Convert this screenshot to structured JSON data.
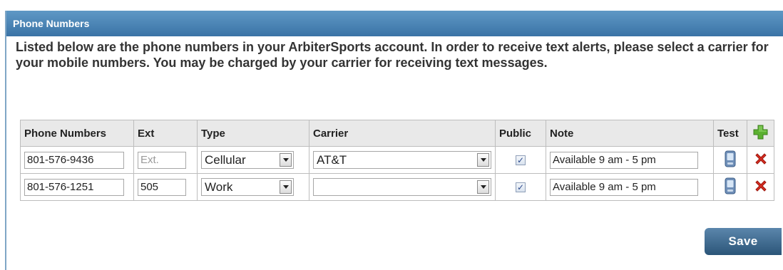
{
  "panel": {
    "title": "Phone Numbers"
  },
  "intro": "Listed below are the phone numbers in your ArbiterSports account. In order to receive text alerts, please select a carrier for your mobile numbers. You may be charged by your carrier for receiving text messages.",
  "table": {
    "headers": {
      "phone": "Phone Numbers",
      "ext": "Ext",
      "type": "Type",
      "carrier": "Carrier",
      "public": "Public",
      "note": "Note",
      "test": "Test"
    },
    "rows": [
      {
        "phone": "801-576-9436",
        "ext": "",
        "ext_placeholder": "Ext.",
        "type": "Cellular",
        "carrier": "AT&T",
        "public": true,
        "note": "Available 9 am - 5 pm"
      },
      {
        "phone": "801-576-1251",
        "ext": "505",
        "ext_placeholder": "Ext.",
        "type": "Work",
        "carrier": "",
        "public": true,
        "note": "Available 9 am - 5 pm"
      }
    ]
  },
  "save_label": "Save",
  "colors": {
    "header_bar": "#3b73a6",
    "save_button": "#2b5578",
    "add_icon": "#5bb030",
    "delete_icon": "#d62b1f"
  },
  "icons": {
    "add": "plus-icon",
    "delete": "delete-x-icon",
    "test": "phone-icon"
  }
}
